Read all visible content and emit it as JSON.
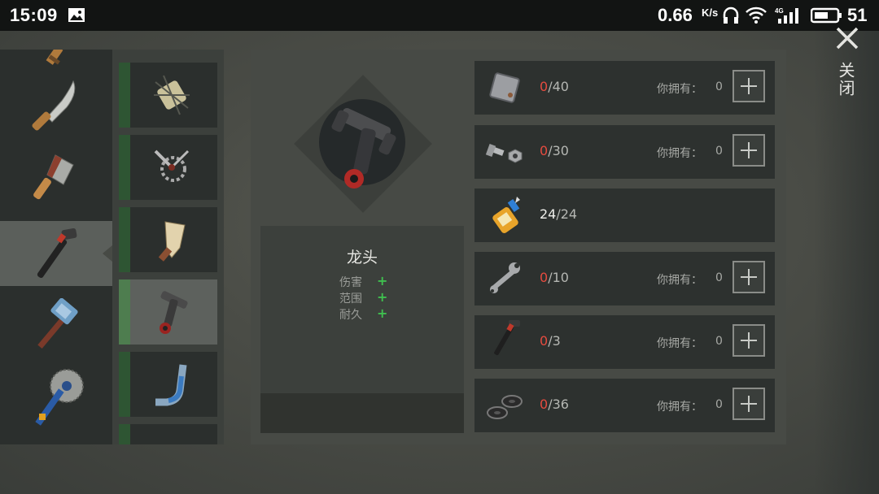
{
  "status_bar": {
    "time": "15:09",
    "net_speed": "0.66",
    "net_unit": "K/s",
    "battery": "51"
  },
  "close": {
    "label": "关闭",
    "icon": "close-icon"
  },
  "tools": [
    {
      "name": "blade-top-partial",
      "selected": false
    },
    {
      "name": "machete",
      "selected": false
    },
    {
      "name": "cleaver",
      "selected": false
    },
    {
      "name": "pipe-wrench",
      "selected": true
    },
    {
      "name": "hammer",
      "selected": false
    },
    {
      "name": "saw-mace",
      "selected": false
    }
  ],
  "parts": [
    {
      "name": "spiked-roll",
      "selected": false
    },
    {
      "name": "gear-blades",
      "selected": false
    },
    {
      "name": "bone-club",
      "selected": false
    },
    {
      "name": "tap-pipe",
      "selected": true
    },
    {
      "name": "bent-pipe",
      "selected": false
    },
    {
      "name": "partial-item",
      "selected": false
    }
  ],
  "item": {
    "name": "龙头",
    "stats": [
      {
        "label": "伤害",
        "value": "+"
      },
      {
        "label": "范围",
        "value": "+"
      },
      {
        "label": "耐久",
        "value": "+"
      }
    ]
  },
  "requirements": [
    {
      "icon": "metal-plate-icon",
      "have": "0",
      "need": "/40",
      "own_label": "你拥有：",
      "own_value": "0",
      "status": "missing"
    },
    {
      "icon": "bolt-nut-icon",
      "have": "0",
      "need": "/30",
      "own_label": "你拥有：",
      "own_value": "0",
      "status": "missing"
    },
    {
      "icon": "glue-icon",
      "have": "24",
      "need": "/24",
      "own_label": "",
      "own_value": "",
      "status": "complete"
    },
    {
      "icon": "wrench-icon",
      "have": "0",
      "need": "/10",
      "own_label": "你拥有：",
      "own_value": "0",
      "status": "missing"
    },
    {
      "icon": "pipe-wrench-icon",
      "have": "0",
      "need": "/3",
      "own_label": "你拥有：",
      "own_value": "0",
      "status": "missing"
    },
    {
      "icon": "washer-icon",
      "have": "0",
      "need": "/36",
      "own_label": "你拥有：",
      "own_value": "0",
      "status": "missing"
    }
  ],
  "colors": {
    "missing": "#e54b3f",
    "complete": "#f0f0ec",
    "accent_green": "#3fbf4f"
  }
}
